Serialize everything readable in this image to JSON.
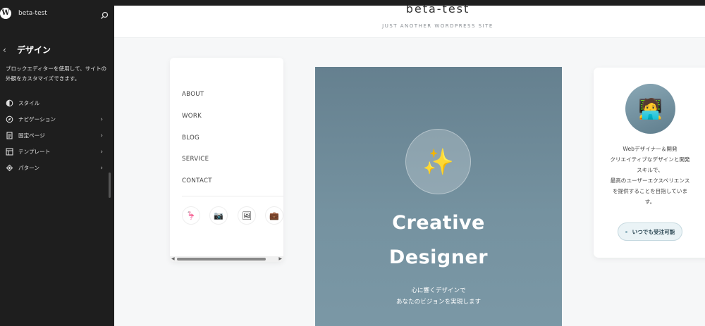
{
  "sidebar": {
    "logo_letter": "W",
    "site_name": "beta-test",
    "back_label": "‹",
    "title": "デザイン",
    "description": "ブロックエディターを使用して、サイトの外観をカスタマイズできます。",
    "items": [
      {
        "label": "スタイル",
        "icon": "styles-icon",
        "has_arrow": false
      },
      {
        "label": "ナビゲーション",
        "icon": "navigation-icon",
        "has_arrow": true
      },
      {
        "label": "固定ページ",
        "icon": "page-icon",
        "has_arrow": true
      },
      {
        "label": "テンプレート",
        "icon": "template-icon",
        "has_arrow": true
      },
      {
        "label": "パターン",
        "icon": "pattern-icon",
        "has_arrow": true
      }
    ],
    "arrow_glyph": "›"
  },
  "header": {
    "site_title": "beta-test",
    "tagline": "JUST ANOTHER WORDPRESS SITE"
  },
  "nav_menu": {
    "items": [
      "ABOUT",
      "WORK",
      "BLOG",
      "SERVICE",
      "CONTACT"
    ],
    "social_icons": [
      {
        "glyph": "🦩",
        "icon": "flamingo-icon"
      },
      {
        "glyph": "📷",
        "icon": "camera-icon"
      },
      {
        "glyph": "🖼",
        "icon": "picture-icon"
      },
      {
        "glyph": "💼",
        "icon": "briefcase-icon"
      }
    ]
  },
  "hero": {
    "icon_glyph": "✨",
    "title_line1": "Creative",
    "title_line2": "Designer",
    "sub_line1": "心に響くデザインで",
    "sub_line2": "あなたのビジョンを実現します"
  },
  "profile": {
    "avatar_glyph": "🧑‍💻",
    "lines": [
      "Webデザイナー＆開発",
      "クリエイティブなデザインと開発",
      "スキルで、",
      "最高のユーザーエクスペリエンス",
      "を提供することを目指していま",
      "す。"
    ],
    "button_label": "いつでも受注可能"
  },
  "colors": {
    "sidebar_bg": "#1e1e1e",
    "hero_bg": "#6a8796",
    "canvas_bg": "#f6f7f8",
    "button_bg": "#eaf3f6"
  }
}
